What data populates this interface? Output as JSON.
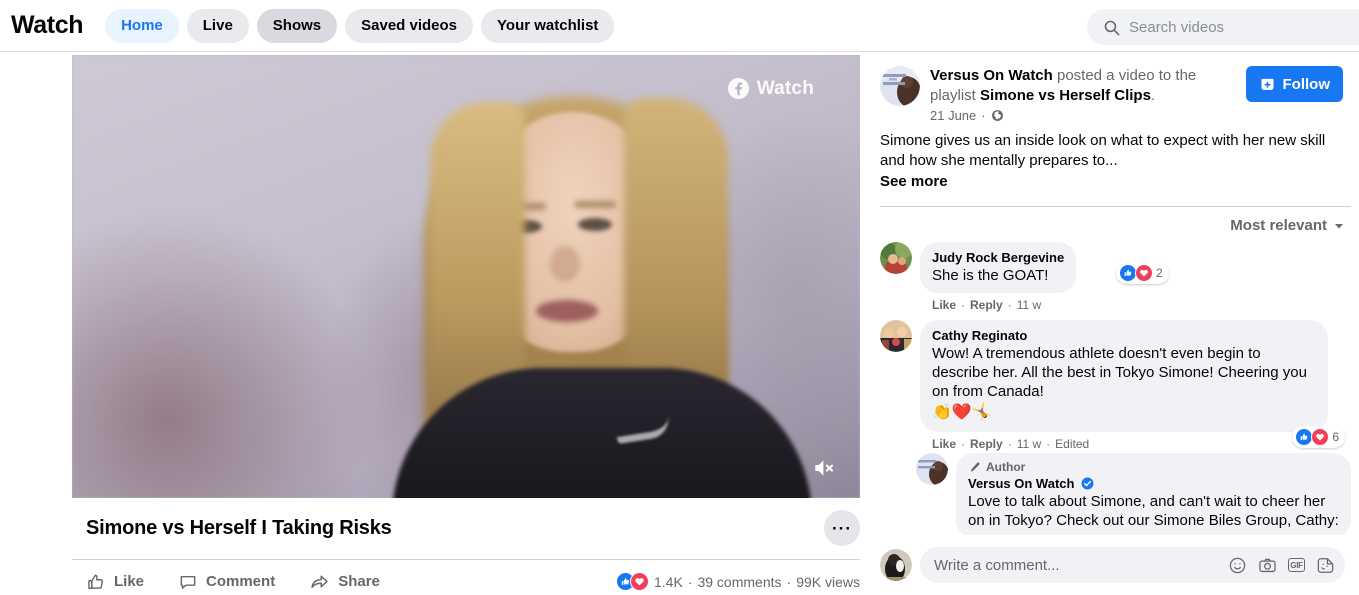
{
  "header": {
    "brand": "Watch",
    "tabs": [
      {
        "label": "Home",
        "state": "active"
      },
      {
        "label": "Live",
        "state": "default"
      },
      {
        "label": "Shows",
        "state": "hover"
      },
      {
        "label": "Saved videos",
        "state": "default"
      },
      {
        "label": "Your watchlist",
        "state": "default"
      }
    ],
    "search_placeholder": "Search videos",
    "search_icon": "search-icon"
  },
  "video": {
    "watermark": "Watch",
    "watermark_icon": "facebook-icon",
    "mute_icon": "speaker-muted-icon",
    "title": "Simone vs Herself I Taking Risks",
    "more_label": "···",
    "actions": [
      {
        "label": "Like",
        "icon": "thumbs-up-icon"
      },
      {
        "label": "Comment",
        "icon": "comment-bubble-icon"
      },
      {
        "label": "Share",
        "icon": "share-arrow-icon"
      }
    ],
    "reaction_count": "1.4K",
    "comment_count": "39 comments",
    "view_count": "99K views",
    "separator": "·"
  },
  "post": {
    "author": "Versus On Watch",
    "action_text": " posted a video to the playlist ",
    "playlist": "Simone vs Herself Clips",
    "period": ".",
    "date": "21 June",
    "privacy_icon": "globe-icon",
    "follow_label": "Follow",
    "follow_icon": "follow-plus-icon",
    "description": "Simone gives us an inside look on what to expect with her new skill and how she mentally prepares to...",
    "see_more": "See more"
  },
  "comments": {
    "sort_label": "Most relevant",
    "sort_icon": "chevron-down-icon",
    "items": [
      {
        "name": "Judy Rock Bergevine",
        "text": "She is the GOAT!",
        "emoji": "",
        "like": "Like",
        "reply": "Reply",
        "time": "11 w",
        "edited": "",
        "reaction_count": "2",
        "badge_position": "inline"
      },
      {
        "name": "Cathy Reginato",
        "text": "Wow! A tremendous athlete doesn't even begin to describe her. All the best in Tokyo Simone! Cheering you on from Canada!",
        "emoji": "👏❤️🤸",
        "like": "Like",
        "reply": "Reply",
        "time": "11 w",
        "edited": "Edited",
        "reaction_count": "6",
        "badge_position": "bottom-right"
      }
    ],
    "reply": {
      "author_tag": "Author",
      "author_tag_icon": "microphone-icon",
      "name": "Versus On Watch",
      "verified_icon": "verified-badge-icon",
      "text": "Love to talk about Simone, and can't wait to cheer her on in Tokyo? Check out our Simone Biles Group, Cathy:"
    }
  },
  "composer": {
    "placeholder": "Write a comment...",
    "icons": [
      {
        "name": "emoji-icon",
        "glyph": "☺"
      },
      {
        "name": "camera-icon",
        "glyph": ""
      },
      {
        "name": "gif-icon",
        "glyph": "GIF"
      },
      {
        "name": "sticker-icon",
        "glyph": ""
      }
    ]
  },
  "colors": {
    "accent": "#1877f2",
    "like": "#1877f2",
    "love": "#f33e58",
    "pill": "#e8eaed",
    "pill_active": "#e7f3ff",
    "bubble": "#f0f2f5"
  }
}
